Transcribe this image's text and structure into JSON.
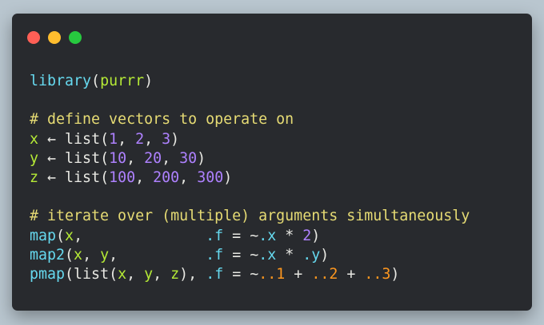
{
  "colors": {
    "background": "#b9c6cf",
    "window": "#282a2e",
    "close": "#ff5f56",
    "minimize": "#ffbd2e",
    "maximize": "#27c93f",
    "plain": "#e8e8e3",
    "function": "#66d9ef",
    "variable": "#b5ea36",
    "number": "#ae81ff",
    "comment": "#e6db74",
    "arg": "#fd971f"
  },
  "window_controls": [
    {
      "name": "close",
      "color": "#ff5f56"
    },
    {
      "name": "minimize",
      "color": "#ffbd2e"
    },
    {
      "name": "maximize",
      "color": "#27c93f"
    }
  ],
  "code_lines": [
    [
      {
        "t": "library",
        "c": "function"
      },
      {
        "t": "(",
        "c": "plain"
      },
      {
        "t": "purrr",
        "c": "variable"
      },
      {
        "t": ")",
        "c": "plain"
      }
    ],
    [],
    [
      {
        "t": "# define vectors to operate on",
        "c": "comment"
      }
    ],
    [
      {
        "t": "x",
        "c": "variable"
      },
      {
        "t": " ← ",
        "c": "plain"
      },
      {
        "t": "list",
        "c": "plain"
      },
      {
        "t": "(",
        "c": "plain"
      },
      {
        "t": "1",
        "c": "number"
      },
      {
        "t": ", ",
        "c": "plain"
      },
      {
        "t": "2",
        "c": "number"
      },
      {
        "t": ", ",
        "c": "plain"
      },
      {
        "t": "3",
        "c": "number"
      },
      {
        "t": ")",
        "c": "plain"
      }
    ],
    [
      {
        "t": "y",
        "c": "variable"
      },
      {
        "t": " ← ",
        "c": "plain"
      },
      {
        "t": "list",
        "c": "plain"
      },
      {
        "t": "(",
        "c": "plain"
      },
      {
        "t": "10",
        "c": "number"
      },
      {
        "t": ", ",
        "c": "plain"
      },
      {
        "t": "20",
        "c": "number"
      },
      {
        "t": ", ",
        "c": "plain"
      },
      {
        "t": "30",
        "c": "number"
      },
      {
        "t": ")",
        "c": "plain"
      }
    ],
    [
      {
        "t": "z",
        "c": "variable"
      },
      {
        "t": " ← ",
        "c": "plain"
      },
      {
        "t": "list",
        "c": "plain"
      },
      {
        "t": "(",
        "c": "plain"
      },
      {
        "t": "100",
        "c": "number"
      },
      {
        "t": ", ",
        "c": "plain"
      },
      {
        "t": "200",
        "c": "number"
      },
      {
        "t": ", ",
        "c": "plain"
      },
      {
        "t": "300",
        "c": "number"
      },
      {
        "t": ")",
        "c": "plain"
      }
    ],
    [],
    [
      {
        "t": "# iterate over (multiple) arguments simultaneously",
        "c": "comment"
      }
    ],
    [
      {
        "t": "map",
        "c": "function"
      },
      {
        "t": "(",
        "c": "plain"
      },
      {
        "t": "x",
        "c": "variable"
      },
      {
        "t": ",              ",
        "c": "plain"
      },
      {
        "t": ".f",
        "c": "function"
      },
      {
        "t": " = ~",
        "c": "plain"
      },
      {
        "t": ".x",
        "c": "function"
      },
      {
        "t": " * ",
        "c": "plain"
      },
      {
        "t": "2",
        "c": "number"
      },
      {
        "t": ")",
        "c": "plain"
      }
    ],
    [
      {
        "t": "map2",
        "c": "function"
      },
      {
        "t": "(",
        "c": "plain"
      },
      {
        "t": "x",
        "c": "variable"
      },
      {
        "t": ", ",
        "c": "plain"
      },
      {
        "t": "y",
        "c": "variable"
      },
      {
        "t": ",          ",
        "c": "plain"
      },
      {
        "t": ".f",
        "c": "function"
      },
      {
        "t": " = ~",
        "c": "plain"
      },
      {
        "t": ".x",
        "c": "function"
      },
      {
        "t": " * ",
        "c": "plain"
      },
      {
        "t": ".y",
        "c": "function"
      },
      {
        "t": ")",
        "c": "plain"
      }
    ],
    [
      {
        "t": "pmap",
        "c": "function"
      },
      {
        "t": "(",
        "c": "plain"
      },
      {
        "t": "list",
        "c": "plain"
      },
      {
        "t": "(",
        "c": "plain"
      },
      {
        "t": "x",
        "c": "variable"
      },
      {
        "t": ", ",
        "c": "plain"
      },
      {
        "t": "y",
        "c": "variable"
      },
      {
        "t": ", ",
        "c": "plain"
      },
      {
        "t": "z",
        "c": "variable"
      },
      {
        "t": "), ",
        "c": "plain"
      },
      {
        "t": ".f",
        "c": "function"
      },
      {
        "t": " = ~",
        "c": "plain"
      },
      {
        "t": "..1",
        "c": "arg"
      },
      {
        "t": " + ",
        "c": "plain"
      },
      {
        "t": "..2",
        "c": "arg"
      },
      {
        "t": " + ",
        "c": "plain"
      },
      {
        "t": "..3",
        "c": "arg"
      },
      {
        "t": ")",
        "c": "plain"
      }
    ]
  ]
}
